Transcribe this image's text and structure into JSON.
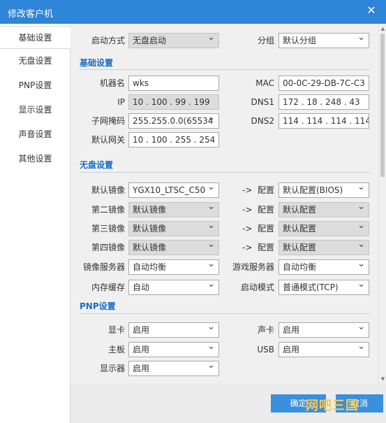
{
  "window": {
    "title": "修改客户机"
  },
  "sidebar": {
    "items": [
      {
        "label": "基础设置",
        "active": true
      },
      {
        "label": "无盘设置"
      },
      {
        "label": "PNP设置"
      },
      {
        "label": "显示设置"
      },
      {
        "label": "声音设置"
      },
      {
        "label": "其他设置"
      }
    ]
  },
  "top": {
    "boot_label": "启动方式",
    "boot_value": "无盘启动",
    "group_label": "分组",
    "group_value": "默认分组"
  },
  "basic": {
    "title": "基础设置",
    "hostname_label": "机器名",
    "hostname_value": "wks",
    "mac_label": "MAC",
    "mac_value": "00-0C-29-DB-7C-C3",
    "ip_label": "IP",
    "ip_value": "10 . 100 . 99 . 199",
    "dns1_label": "DNS1",
    "dns1_value": "172 . 18 . 248 . 43",
    "mask_label": "子网掩码",
    "mask_value": "255.255.0.0(65534",
    "dns2_label": "DNS2",
    "dns2_value": "114 . 114 . 114 . 114",
    "gateway_label": "默认网关",
    "gateway_value": "10 . 100 . 255 . 254"
  },
  "diskless": {
    "title": "无盘设置",
    "arrow": "->",
    "config_label": "配置",
    "rows": [
      {
        "label": "默认镜像",
        "image": "YGX10_LTSC_C50",
        "config": "默认配置(BIOS)",
        "disabled": false
      },
      {
        "label": "第二镜像",
        "image": "默认镜像",
        "config": "默认配置",
        "disabled": true
      },
      {
        "label": "第三镜像",
        "image": "默认镜像",
        "config": "默认配置",
        "disabled": true
      },
      {
        "label": "第四镜像",
        "image": "默认镜像",
        "config": "默认配置",
        "disabled": true
      }
    ],
    "image_server_label": "镜像服务器",
    "image_server_value": "自动均衡",
    "game_server_label": "游戏服务器",
    "game_server_value": "自动均衡",
    "cache_label": "内存缓存",
    "cache_value": "自动",
    "boot_mode_label": "启动模式",
    "boot_mode_value": "普通模式(TCP)"
  },
  "pnp": {
    "title": "PNP设置",
    "gpu_label": "显卡",
    "gpu_value": "启用",
    "sound_label": "声卡",
    "sound_value": "启用",
    "board_label": "主板",
    "board_value": "启用",
    "usb_label": "USB",
    "usb_value": "启用",
    "monitor_label": "显示器",
    "monitor_value": "启用"
  },
  "footer": {
    "ok_label": "确定",
    "cancel_label": "取消",
    "watermark": "网吧三国"
  }
}
